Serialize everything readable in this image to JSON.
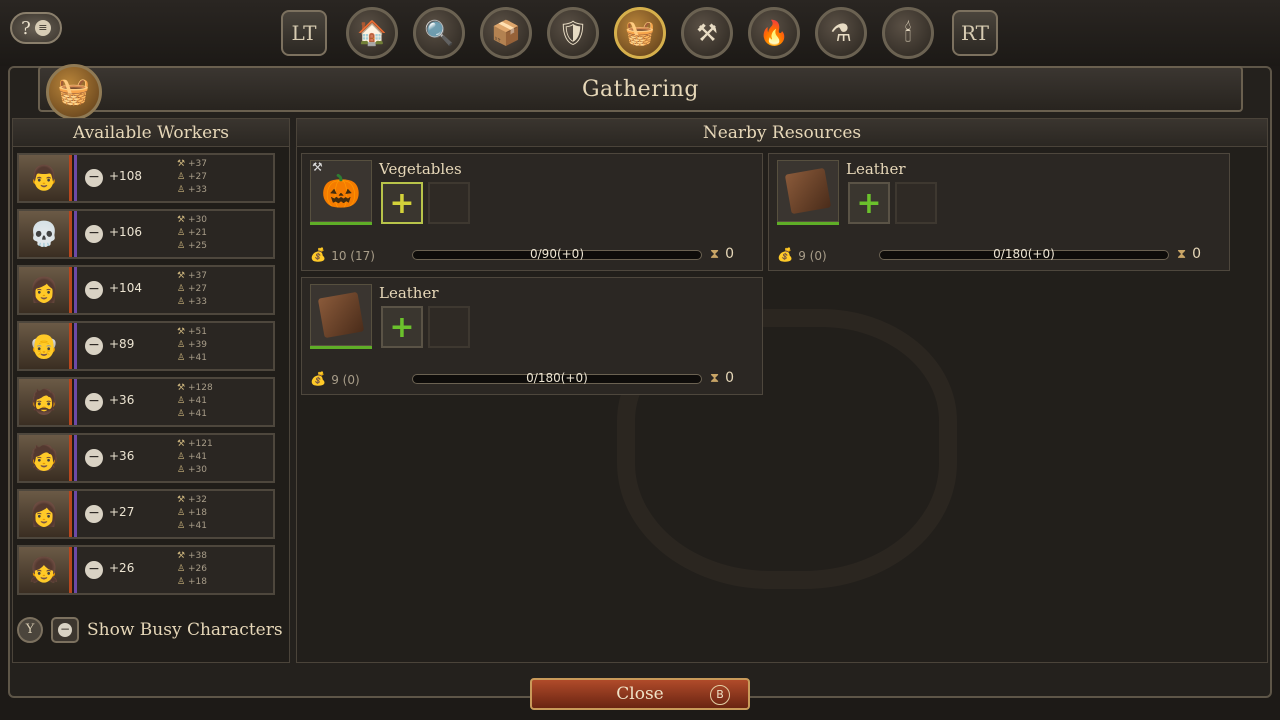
{
  "top_bar": {
    "help_label": "?",
    "left_shoulder": "LT",
    "right_shoulder": "RT",
    "tabs": [
      {
        "icon": "house-icon",
        "glyph": "🏠"
      },
      {
        "icon": "magnifier-icon",
        "glyph": "🔍"
      },
      {
        "icon": "crate-icon",
        "glyph": "📦"
      },
      {
        "icon": "shield-icon",
        "glyph": "🛡"
      },
      {
        "icon": "basket-icon",
        "glyph": "🧺",
        "active": true
      },
      {
        "icon": "anvil-icon",
        "glyph": "⚒"
      },
      {
        "icon": "furnace-icon",
        "glyph": "🔥"
      },
      {
        "icon": "flask-icon",
        "glyph": "⚗"
      },
      {
        "icon": "candle-icon",
        "glyph": "🕯"
      }
    ]
  },
  "header": {
    "title": "Gathering",
    "icon": "basket-icon"
  },
  "workers_panel": {
    "title": "Available Workers",
    "workers": [
      {
        "portrait": "👨",
        "score": "+108",
        "stats": [
          "+37",
          "+27",
          "+33"
        ]
      },
      {
        "portrait": "💀",
        "score": "+106",
        "stats": [
          "+30",
          "+21",
          "+25"
        ]
      },
      {
        "portrait": "👩",
        "score": "+104",
        "stats": [
          "+37",
          "+27",
          "+33"
        ]
      },
      {
        "portrait": "👴",
        "score": "+89",
        "stats": [
          "+51",
          "+39",
          "+41"
        ]
      },
      {
        "portrait": "🧔",
        "score": "+36",
        "stats": [
          "+128",
          "+41",
          "+41"
        ]
      },
      {
        "portrait": "🧑",
        "score": "+36",
        "stats": [
          "+121",
          "+41",
          "+30"
        ]
      },
      {
        "portrait": "👩",
        "score": "+27",
        "stats": [
          "+32",
          "+18",
          "+41"
        ]
      },
      {
        "portrait": "👧",
        "score": "+26",
        "stats": [
          "+38",
          "+26",
          "+18"
        ]
      }
    ],
    "y_button": "Y",
    "show_busy_label": "Show Busy Characters"
  },
  "resources_panel": {
    "title": "Nearby Resources",
    "resources": [
      {
        "name": "Vegetables",
        "icon": "pumpkin-icon",
        "glyph": "🎃",
        "stock": "10 (17)",
        "progress": "0/90(+0)",
        "timer": "0",
        "selected": true,
        "tool": true
      },
      {
        "name": "Leather",
        "icon": "leather-icon",
        "glyph": "🟫",
        "stock": "9 (0)",
        "progress": "0/180(+0)",
        "timer": "0",
        "selected": false,
        "tool": false
      },
      {
        "name": "Leather",
        "icon": "leather-icon",
        "glyph": "🟫",
        "stock": "9 (0)",
        "progress": "0/180(+0)",
        "timer": "0",
        "selected": false,
        "tool": false
      }
    ]
  },
  "footer": {
    "close_label": "Close",
    "close_key": "B"
  }
}
